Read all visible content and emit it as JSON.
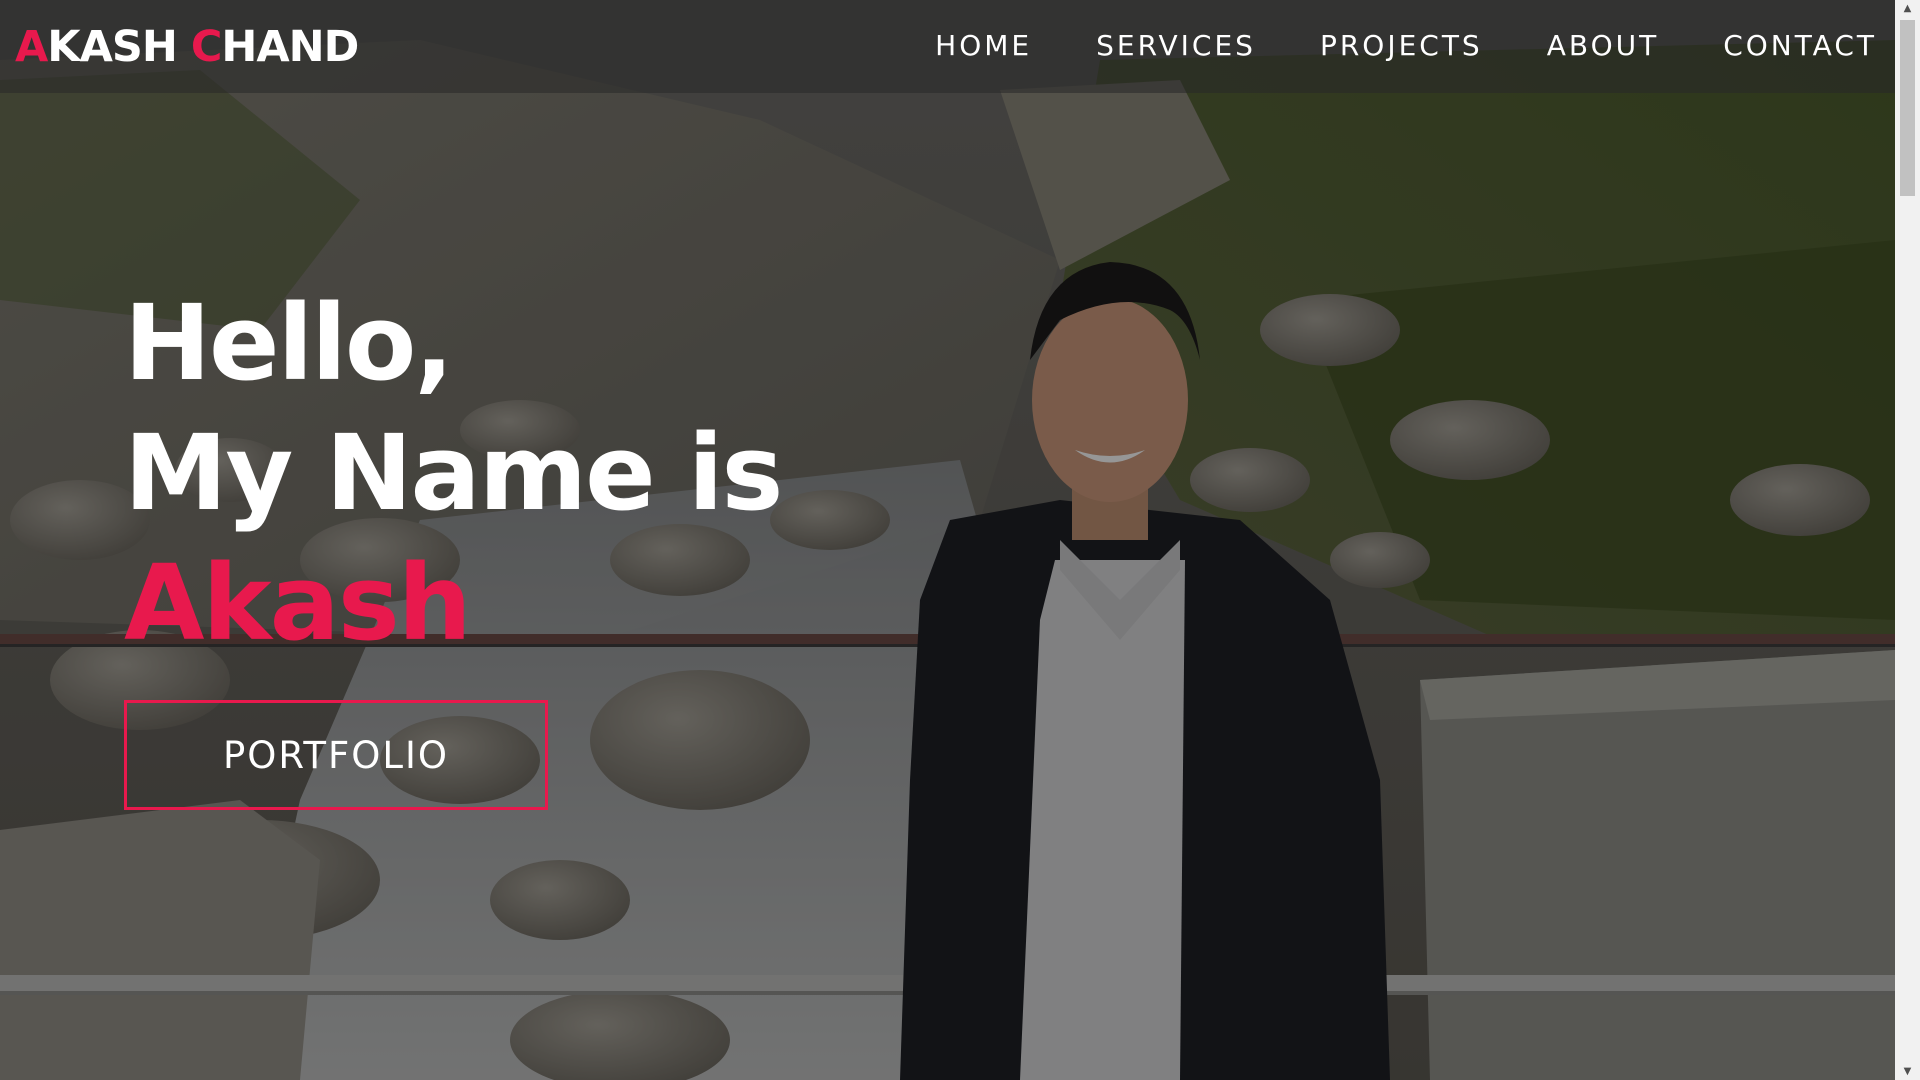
{
  "navbar": {
    "logo_first_initial": "A",
    "logo_first_rest": "KASH ",
    "logo_last_initial": "C",
    "logo_last_rest": "HAND",
    "links": [
      "HOME",
      "SERVICES",
      "PROJECTS",
      "ABOUT",
      "CONTACT"
    ]
  },
  "hero": {
    "line1": "Hello,",
    "line2": "My Name is",
    "name": "Akash",
    "button_label": "PORTFOLIO"
  },
  "colors": {
    "accent": "#e8194d",
    "text": "#ffffff",
    "nav_bg": "#282828"
  },
  "scrollbar": {
    "up_glyph": "▲",
    "down_glyph": "▼"
  }
}
